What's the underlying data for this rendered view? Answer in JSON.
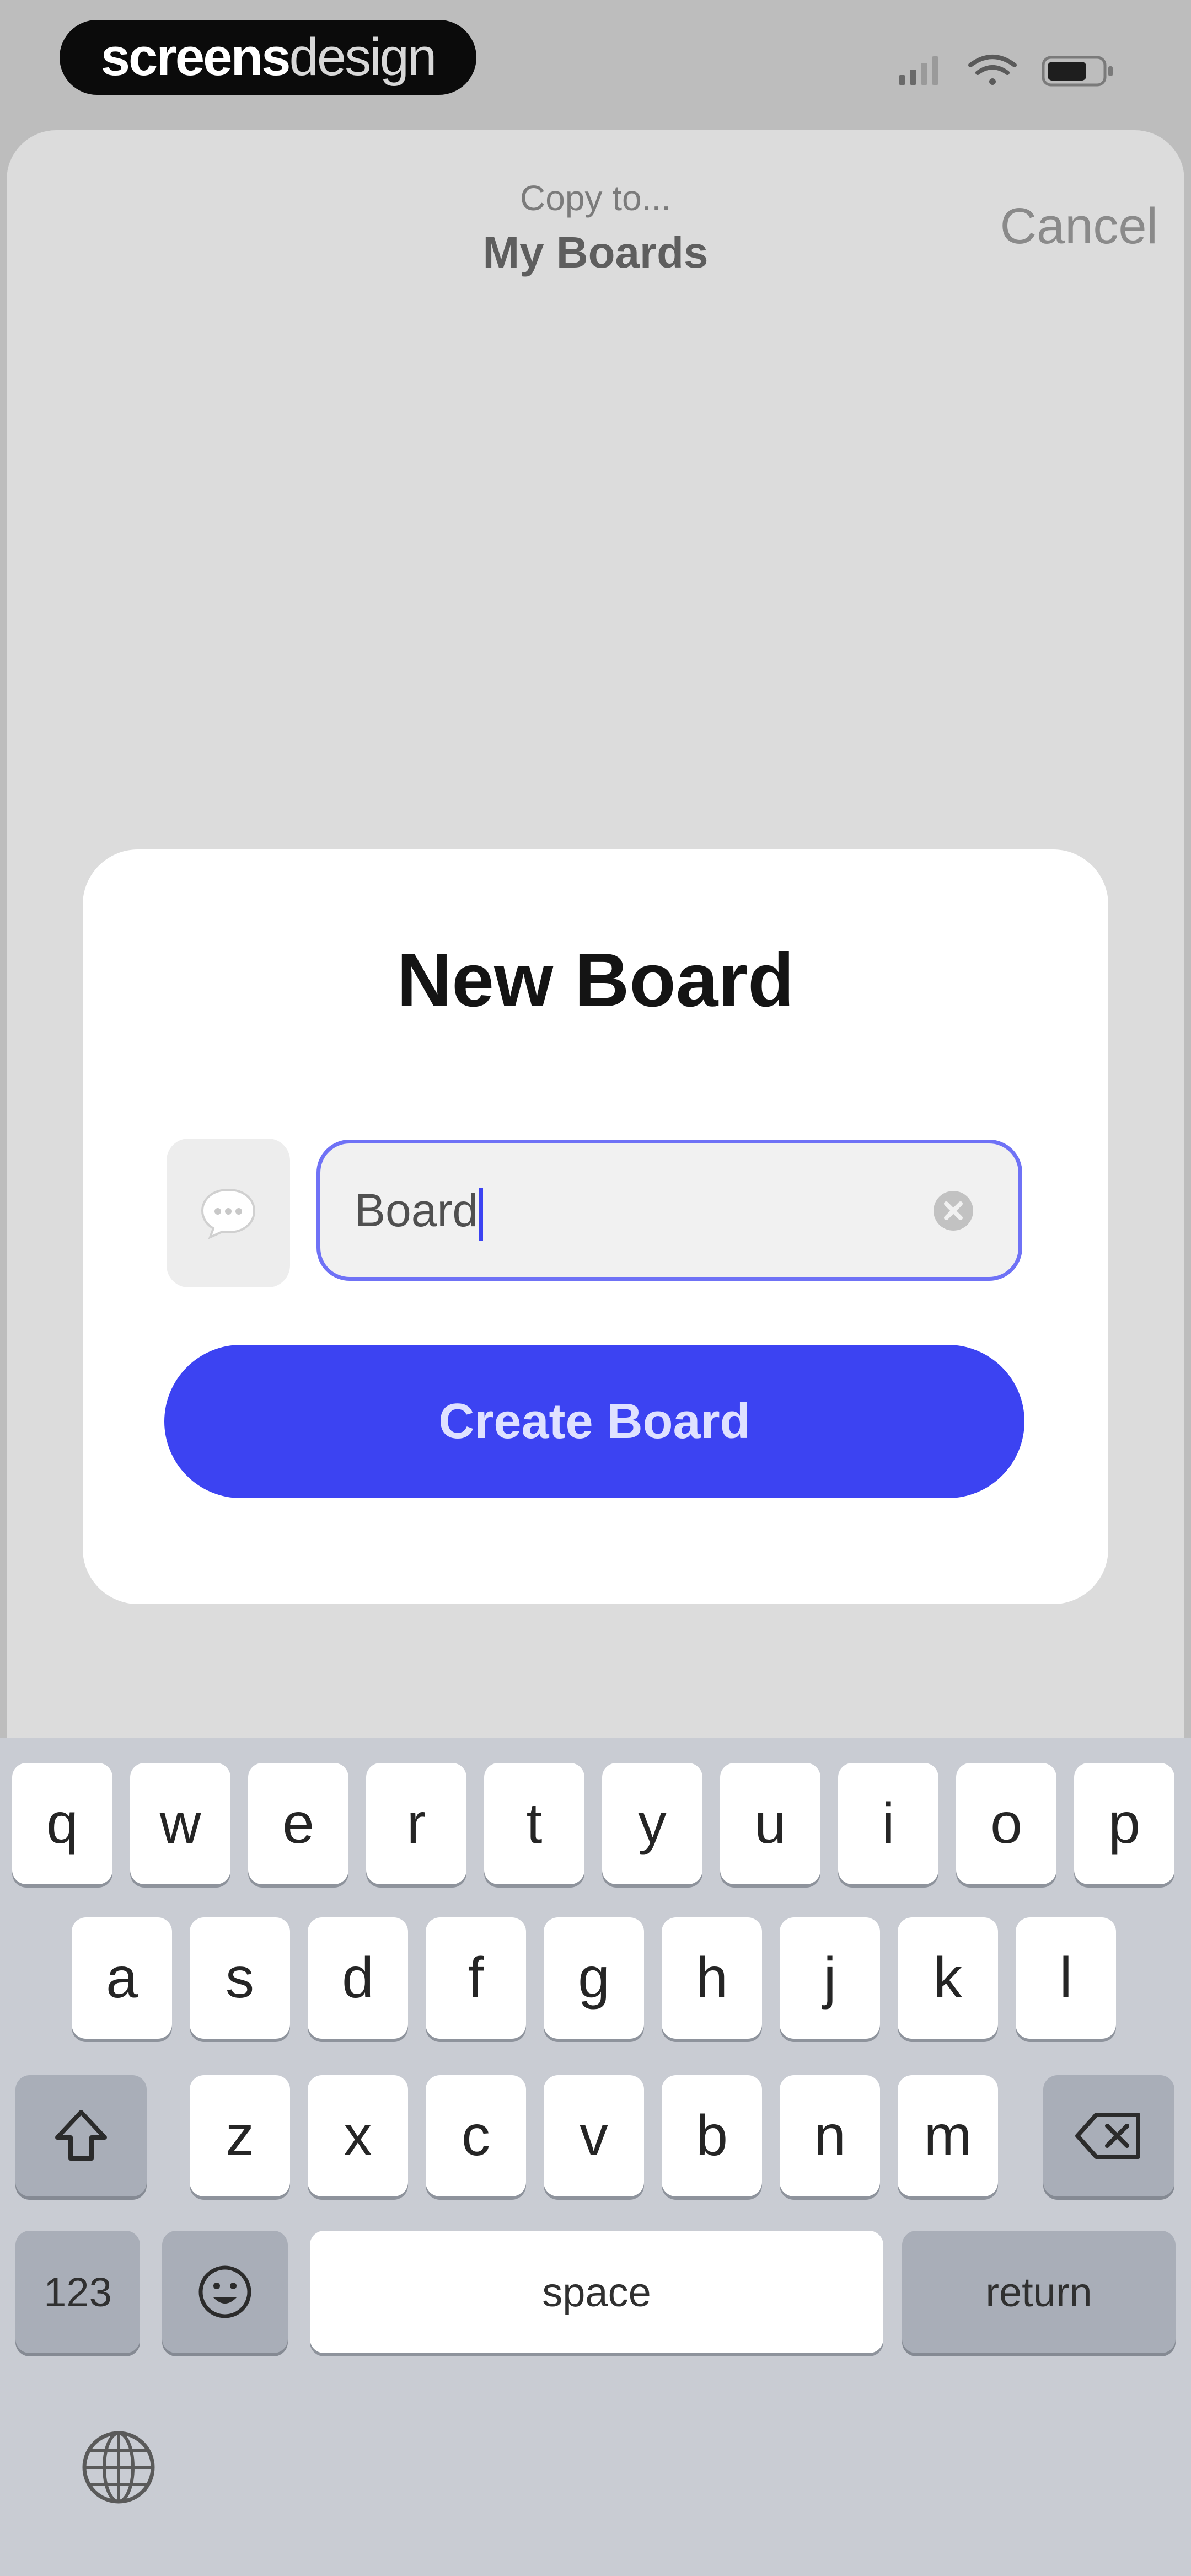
{
  "status_bar": {
    "brand_bold": "screens",
    "brand_light": "design"
  },
  "nav": {
    "subtitle": "Copy to...",
    "title": "My Boards",
    "cancel_label": "Cancel"
  },
  "dialog": {
    "title": "New Board",
    "input_value": "Board",
    "create_label": "Create Board"
  },
  "keyboard": {
    "row1": [
      "q",
      "w",
      "e",
      "r",
      "t",
      "y",
      "u",
      "i",
      "o",
      "p"
    ],
    "row2": [
      "a",
      "s",
      "d",
      "f",
      "g",
      "h",
      "j",
      "k",
      "l"
    ],
    "row3": [
      "z",
      "x",
      "c",
      "v",
      "b",
      "n",
      "m"
    ],
    "numbers_label": "123",
    "space_label": "space",
    "return_label": "return"
  },
  "colors": {
    "accent": "#3c43f2",
    "input_border": "#6f72f6",
    "sheet_background": "#dcdcdc",
    "keyboard_background": "#c9ccd3"
  },
  "icons": [
    "signal-icon",
    "wifi-icon",
    "battery-icon",
    "speech-bubble-icon",
    "clear-icon",
    "shift-icon",
    "delete-icon",
    "emoji-icon",
    "globe-icon"
  ]
}
